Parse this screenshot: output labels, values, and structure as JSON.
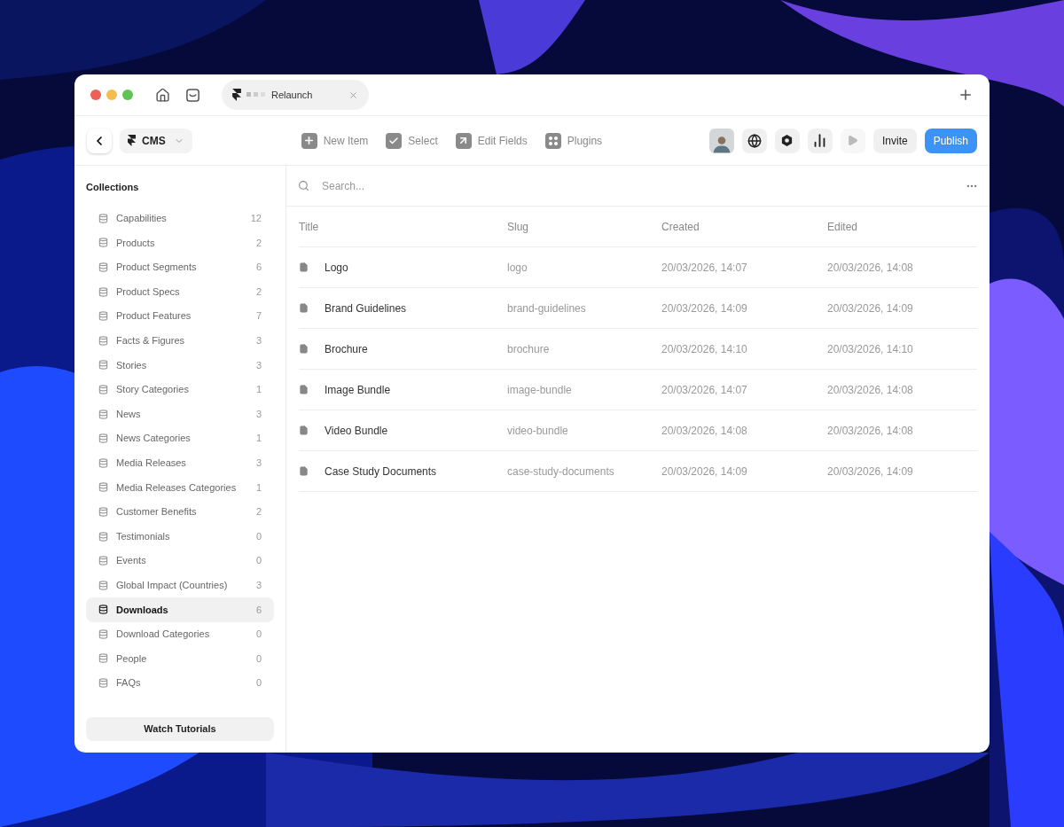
{
  "window": {
    "tab": {
      "title": "Relaunch"
    }
  },
  "toolbar": {
    "project": "CMS",
    "actions": [
      {
        "kind": "new",
        "label": "New Item"
      },
      {
        "kind": "select",
        "label": "Select"
      },
      {
        "kind": "edit",
        "label": "Edit Fields"
      },
      {
        "kind": "plugins",
        "label": "Plugins"
      }
    ],
    "icon_buttons": [
      {
        "kind": "avatar",
        "disabled": false
      },
      {
        "kind": "globe",
        "disabled": false
      },
      {
        "kind": "hexagon",
        "disabled": false
      },
      {
        "kind": "chart",
        "disabled": false
      },
      {
        "kind": "play",
        "disabled": true
      }
    ],
    "invite": "Invite",
    "publish": "Publish"
  },
  "sidebar": {
    "title": "Collections",
    "items": [
      {
        "label": "Capabilities",
        "count": "12",
        "selected": false
      },
      {
        "label": "Products",
        "count": "2",
        "selected": false
      },
      {
        "label": "Product Segments",
        "count": "6",
        "selected": false
      },
      {
        "label": "Product Specs",
        "count": "2",
        "selected": false
      },
      {
        "label": "Product Features",
        "count": "7",
        "selected": false
      },
      {
        "label": "Facts & Figures",
        "count": "3",
        "selected": false
      },
      {
        "label": "Stories",
        "count": "3",
        "selected": false
      },
      {
        "label": "Story Categories",
        "count": "1",
        "selected": false
      },
      {
        "label": "News",
        "count": "3",
        "selected": false
      },
      {
        "label": "News Categories",
        "count": "1",
        "selected": false
      },
      {
        "label": "Media Releases",
        "count": "3",
        "selected": false
      },
      {
        "label": "Media Releases Categories",
        "count": "1",
        "selected": false
      },
      {
        "label": "Customer Benefits",
        "count": "2",
        "selected": false
      },
      {
        "label": "Testimonials",
        "count": "0",
        "selected": false
      },
      {
        "label": "Events",
        "count": "0",
        "selected": false
      },
      {
        "label": "Global Impact (Countries)",
        "count": "3",
        "selected": false
      },
      {
        "label": "Downloads",
        "count": "6",
        "selected": true
      },
      {
        "label": "Download Categories",
        "count": "0",
        "selected": false
      },
      {
        "label": "People",
        "count": "0",
        "selected": false
      },
      {
        "label": "FAQs",
        "count": "0",
        "selected": false
      }
    ],
    "footer_button": "Watch Tutorials"
  },
  "search": {
    "placeholder": "Search..."
  },
  "table": {
    "columns": [
      "Title",
      "Slug",
      "Created",
      "Edited"
    ],
    "rows": [
      [
        "Logo",
        "logo",
        "20/03/2026, 14:07",
        "20/03/2026, 14:08"
      ],
      [
        "Brand Guidelines",
        "brand-guidelines",
        "20/03/2026, 14:09",
        "20/03/2026, 14:09"
      ],
      [
        "Brochure",
        "brochure",
        "20/03/2026, 14:10",
        "20/03/2026, 14:10"
      ],
      [
        "Image Bundle",
        "image-bundle",
        "20/03/2026, 14:07",
        "20/03/2026, 14:08"
      ],
      [
        "Video Bundle",
        "video-bundle",
        "20/03/2026, 14:08",
        "20/03/2026, 14:08"
      ],
      [
        "Case Study Documents",
        "case-study-documents",
        "20/03/2026, 14:09",
        "20/03/2026, 14:09"
      ]
    ]
  }
}
